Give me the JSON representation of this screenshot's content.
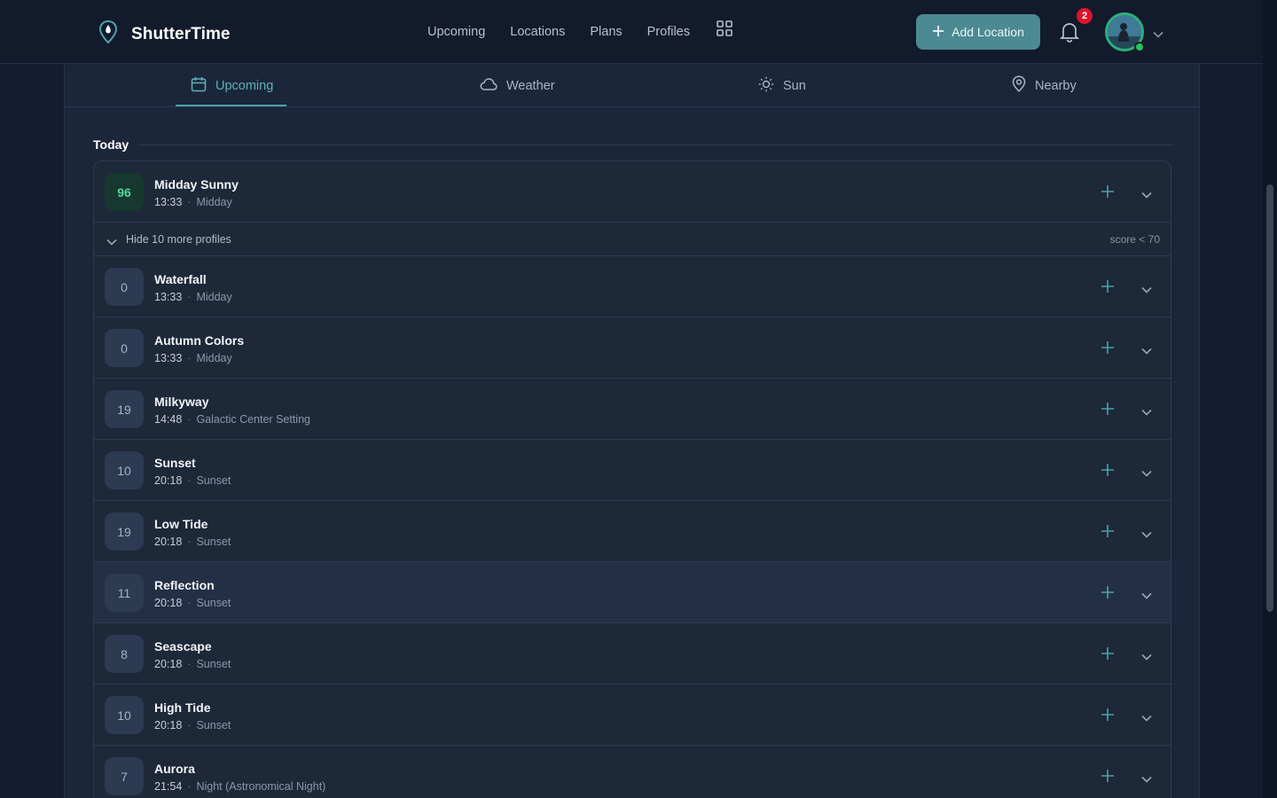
{
  "brand": {
    "name": "ShutterTime"
  },
  "nav": {
    "links": [
      "Upcoming",
      "Locations",
      "Plans",
      "Profiles"
    ]
  },
  "header": {
    "add_location": "Add Location",
    "notification_count": "2"
  },
  "tabs": [
    {
      "label": "Upcoming",
      "icon": "calendar-icon",
      "active": true
    },
    {
      "label": "Weather",
      "icon": "cloud-icon",
      "active": false
    },
    {
      "label": "Sun",
      "icon": "sun-icon",
      "active": false
    },
    {
      "label": "Nearby",
      "icon": "map-pin-icon",
      "active": false
    }
  ],
  "section": {
    "title": "Today"
  },
  "top_item": {
    "score": "96",
    "title": "Midday Sunny",
    "time": "13:33",
    "phase": "Midday"
  },
  "hidden_toggle": {
    "label": "Hide 10 more profiles",
    "note": "score < 70"
  },
  "items": [
    {
      "score": "0",
      "title": "Waterfall",
      "time": "13:33",
      "phase": "Midday"
    },
    {
      "score": "0",
      "title": "Autumn Colors",
      "time": "13:33",
      "phase": "Midday"
    },
    {
      "score": "19",
      "title": "Milkyway",
      "time": "14:48",
      "phase": "Galactic Center Setting"
    },
    {
      "score": "10",
      "title": "Sunset",
      "time": "20:18",
      "phase": "Sunset"
    },
    {
      "score": "19",
      "title": "Low Tide",
      "time": "20:18",
      "phase": "Sunset"
    },
    {
      "score": "11",
      "title": "Reflection",
      "time": "20:18",
      "phase": "Sunset"
    },
    {
      "score": "8",
      "title": "Seascape",
      "time": "20:18",
      "phase": "Sunset"
    },
    {
      "score": "10",
      "title": "High Tide",
      "time": "20:18",
      "phase": "Sunset"
    },
    {
      "score": "7",
      "title": "Aurora",
      "time": "21:54",
      "phase": "Night (Astronomical Night)"
    }
  ],
  "colors": {
    "accent": "#4b8a92",
    "accent_text": "#5bb3b8",
    "good_score": "#4fd69c",
    "badge": "#d9142b"
  }
}
